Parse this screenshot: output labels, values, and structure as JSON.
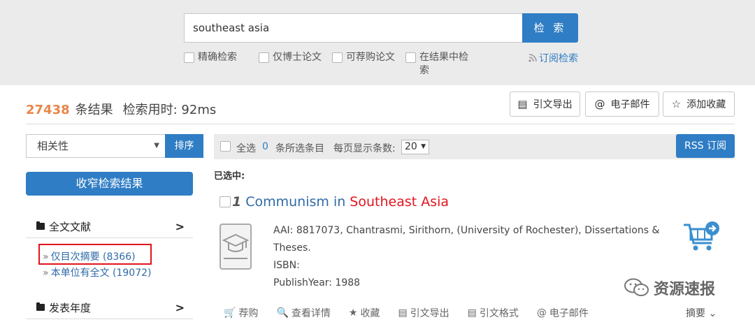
{
  "search": {
    "query": "southeast asia",
    "button_label": "检 索",
    "options": [
      "精确检索",
      "仅博士论文",
      "可荐购论文",
      "在结果中检",
      "索"
    ],
    "subscribe_label": "订阅检索"
  },
  "results_summary": {
    "count": "27438",
    "count_label": "条结果",
    "time_label": "检索用时: 92ms"
  },
  "actions_top": {
    "export": "引文导出",
    "email": "电子邮件",
    "favorite": "添加收藏"
  },
  "sidebar": {
    "sort_value": "相关性",
    "sort_button": "排序",
    "narrow_button": "收窄检索结果",
    "facets": [
      {
        "label": "全文文献",
        "items": [
          {
            "label": "仅目次摘要",
            "count": "(8366)"
          },
          {
            "label": "本单位有全文",
            "count": "(19072)"
          }
        ]
      },
      {
        "label": "发表年度"
      }
    ]
  },
  "toolbar": {
    "select_all": "全选",
    "selected_count": "0",
    "selected_label": "条所选条目",
    "per_page_label": "每页显示条数:",
    "per_page_value": "20",
    "rss_button": "RSS 订阅",
    "selected_heading": "已选中:"
  },
  "result": {
    "number": "1",
    "title_part1": "Communism in",
    "title_part2": "Southeast Asia",
    "meta_line1": "AAI: 8817073, Chantrasmi, Sirithorn, (University of Rochester), Dissertations &",
    "meta_line2": "Theses.",
    "meta_line3": "ISBN:",
    "meta_line4": "PublishYear: 1988",
    "actions": [
      "荐购",
      "查看详情",
      "收藏",
      "引文导出",
      "引文格式",
      "电子邮件"
    ],
    "summary_label": "摘要"
  },
  "watermark": "资源速报",
  "colors": {
    "accent": "#2f7dc4",
    "count": "#e8864a",
    "highlight": "#e0141e"
  }
}
